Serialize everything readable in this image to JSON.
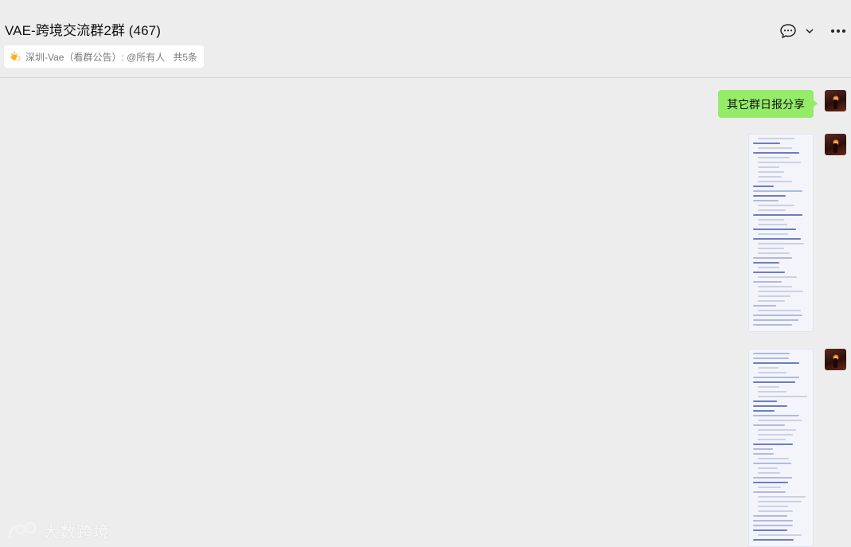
{
  "window": {
    "title": "VAE-跨境交流群2群 (467)",
    "controls": {
      "pin_icon": "pin-icon",
      "minimize_icon": "minimize-icon",
      "maximize_icon": "maximize-icon",
      "close_icon": "close-icon"
    }
  },
  "header": {
    "chat_icon": "chat-bubble-icon",
    "dropdown_icon": "chevron-down-icon",
    "more_icon": "more-icon"
  },
  "notice": {
    "icon": "sun-icon",
    "text": "深圳-Vae（看群公告）: @所有人 ...",
    "count": "共5条"
  },
  "messages": [
    {
      "type": "text",
      "side": "right",
      "text": "其它群日报分享"
    },
    {
      "type": "image",
      "side": "right",
      "content": "document-screenshot"
    },
    {
      "type": "image",
      "side": "right",
      "content": "document-screenshot"
    }
  ],
  "watermark": {
    "text": "大数跨境"
  },
  "colors": {
    "background": "#ededed",
    "bubble_self": "#95ec69",
    "notice_bg": "#ffffff"
  }
}
